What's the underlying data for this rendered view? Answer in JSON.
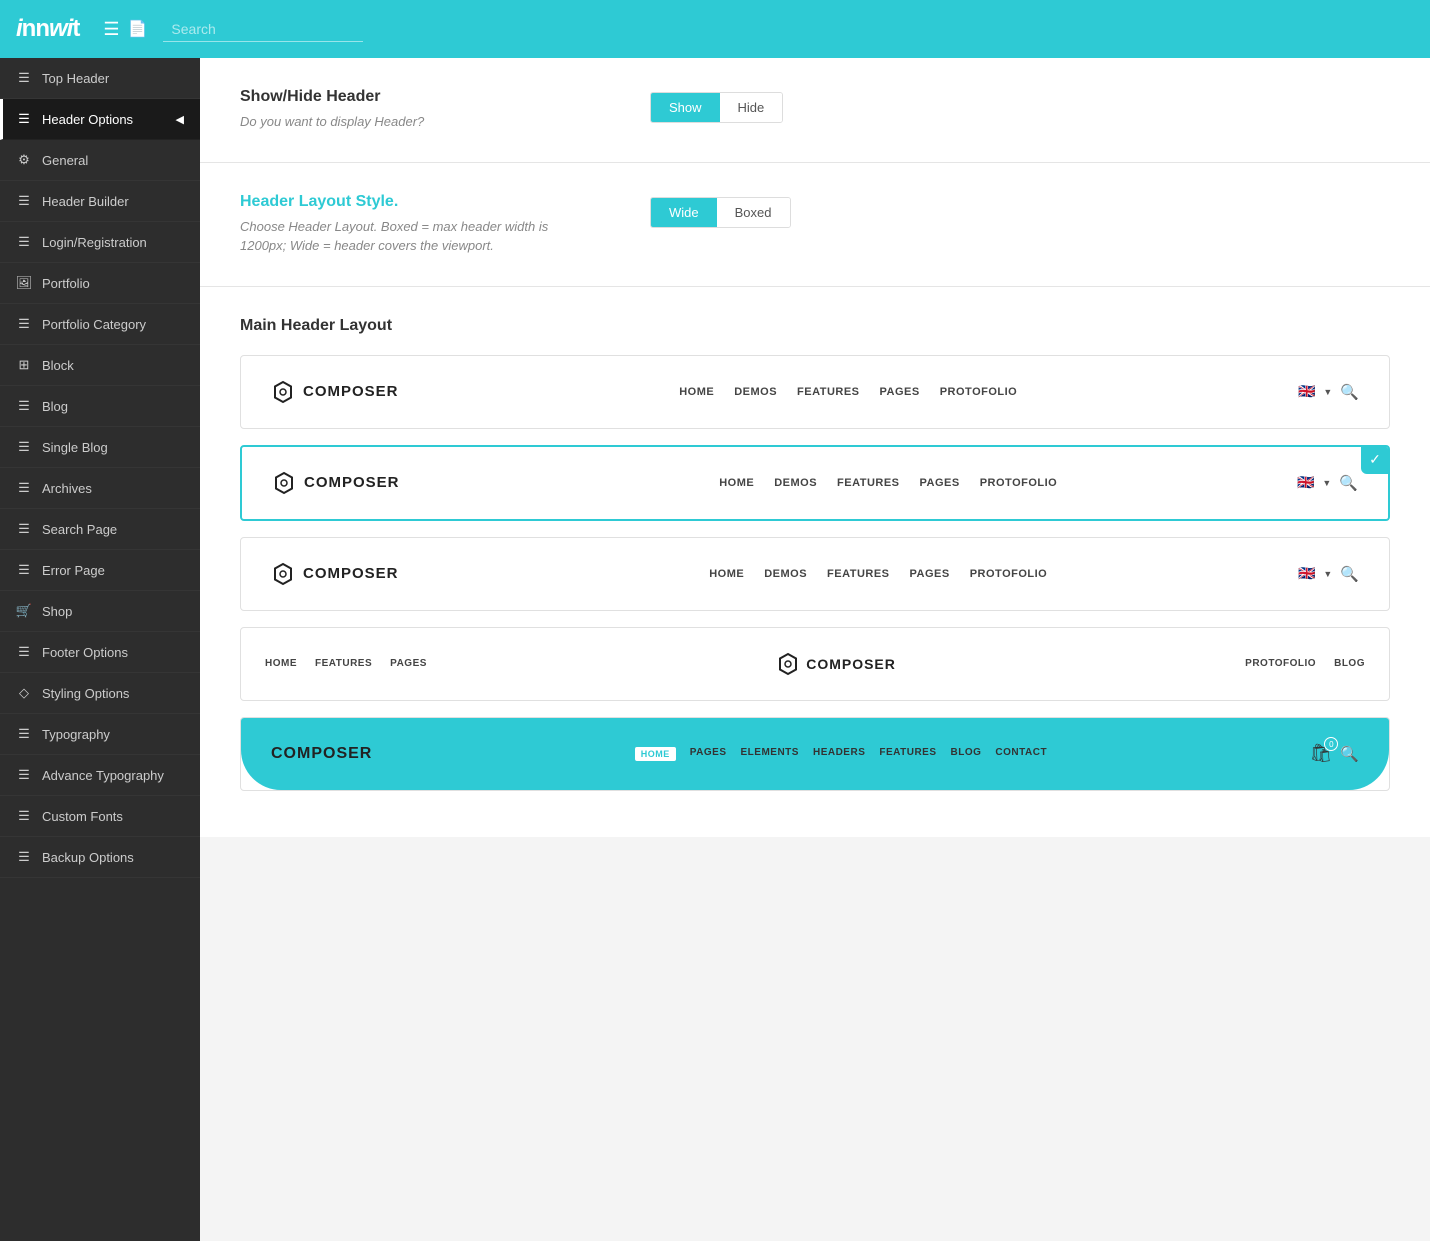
{
  "brand": {
    "name": "innwit",
    "logo_text": "innwit"
  },
  "topbar": {
    "search_placeholder": "Search",
    "icon1": "menu-icon",
    "icon2": "search-icon"
  },
  "sidebar": {
    "items": [
      {
        "id": "top-header",
        "label": "Top Header",
        "icon": "☰",
        "active": false
      },
      {
        "id": "header-options",
        "label": "Header Options",
        "icon": "☰",
        "active": true
      },
      {
        "id": "general",
        "label": "General",
        "icon": "⚙",
        "active": false
      },
      {
        "id": "header-builder",
        "label": "Header Builder",
        "icon": "☰",
        "active": false
      },
      {
        "id": "login-registration",
        "label": "Login/Registration",
        "icon": "☰",
        "active": false
      },
      {
        "id": "portfolio",
        "label": "Portfolio",
        "icon": "🖼",
        "active": false
      },
      {
        "id": "portfolio-category",
        "label": "Portfolio Category",
        "icon": "☰",
        "active": false
      },
      {
        "id": "block",
        "label": "Block",
        "icon": "⊞",
        "active": false
      },
      {
        "id": "blog",
        "label": "Blog",
        "icon": "☰",
        "active": false
      },
      {
        "id": "single-blog",
        "label": "Single Blog",
        "icon": "☰",
        "active": false
      },
      {
        "id": "archives",
        "label": "Archives",
        "icon": "☰",
        "active": false
      },
      {
        "id": "search-page",
        "label": "Search Page",
        "icon": "☰",
        "active": false
      },
      {
        "id": "error-page",
        "label": "Error Page",
        "icon": "☰",
        "active": false
      },
      {
        "id": "shop",
        "label": "Shop",
        "icon": "🛒",
        "active": false
      },
      {
        "id": "footer-options",
        "label": "Footer Options",
        "icon": "☰",
        "active": false
      },
      {
        "id": "styling-options",
        "label": "Styling Options",
        "icon": "◇",
        "active": false
      },
      {
        "id": "typography",
        "label": "Typography",
        "icon": "☰",
        "active": false
      },
      {
        "id": "advance-typography",
        "label": "Advance Typography",
        "icon": "☰",
        "active": false
      },
      {
        "id": "custom-fonts",
        "label": "Custom Fonts",
        "icon": "☰",
        "active": false
      },
      {
        "id": "backup-options",
        "label": "Backup Options",
        "icon": "☰",
        "active": false
      }
    ]
  },
  "show_hide_header": {
    "title": "Show/Hide Header",
    "description": "Do you want to display Header?",
    "buttons": [
      "Show",
      "Hide"
    ],
    "active": "Show"
  },
  "header_layout_style": {
    "title": "Header Layout Style.",
    "description": "Choose Header Layout. Boxed = max header width is 1200px; Wide = header covers the viewport.",
    "buttons": [
      "Wide",
      "Boxed"
    ],
    "active": "Wide"
  },
  "main_header_layout": {
    "title": "Main Header Layout",
    "options": [
      {
        "id": "layout-1",
        "selected": false,
        "logo_text": "COMPOSER",
        "logo_position": "left",
        "nav_items": [
          "HOME",
          "DEMOS",
          "FEATURES",
          "PAGES",
          "PROTOFOLIO"
        ],
        "has_flag": true,
        "has_search": true
      },
      {
        "id": "layout-2",
        "selected": true,
        "logo_text": "COMPOSER",
        "logo_position": "left",
        "nav_items": [
          "HOME",
          "DEMOS",
          "FEATURES",
          "PAGES",
          "PROTOFOLIO"
        ],
        "has_flag": true,
        "has_search": true
      },
      {
        "id": "layout-3",
        "selected": false,
        "logo_text": "COMPOSER",
        "logo_position": "left",
        "nav_items": [
          "HOME",
          "DEMOS",
          "FEATURES",
          "PAGES",
          "PROTOFOLIO"
        ],
        "has_flag": true,
        "has_search": true
      },
      {
        "id": "layout-4",
        "selected": false,
        "logo_text": "COMPOSER",
        "logo_position": "center",
        "left_nav": [
          "HOME",
          "FEATURES",
          "PAGES"
        ],
        "right_nav": [
          "PROTOFOLIO",
          "BLOG"
        ]
      },
      {
        "id": "layout-5",
        "selected": false,
        "logo_text": "COMPOSER",
        "style": "colored",
        "nav_items": [
          "HOME",
          "PAGES",
          "ELEMENTS",
          "HEADERS",
          "FEATURES",
          "BLOG",
          "CONTACT"
        ],
        "active_nav": "HOME"
      }
    ]
  },
  "colors": {
    "cyan": "#2ecad4",
    "dark": "#2d2d2d",
    "text": "#333",
    "muted": "#888"
  }
}
